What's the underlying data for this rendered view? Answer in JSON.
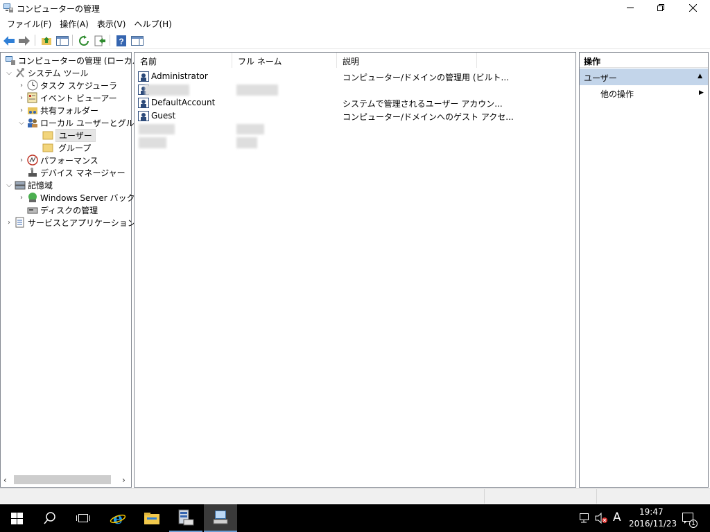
{
  "window": {
    "title": "コンピューターの管理"
  },
  "menu": [
    "ファイル(F)",
    "操作(A)",
    "表示(V)",
    "ヘルプ(H)"
  ],
  "tree": {
    "root": "コンピューターの管理 (ローカル)",
    "system_tools": "システム ツール",
    "task_scheduler": "タスク スケジューラ",
    "event_viewer": "イベント ビューアー",
    "shared_folders": "共有フォルダー",
    "local_users": "ローカル ユーザーとグループ",
    "users": "ユーザー",
    "groups": "グループ",
    "performance": "パフォーマンス",
    "device_manager": "デバイス マネージャー",
    "storage": "記憶域",
    "windows_backup": "Windows Server バックア",
    "disk_management": "ディスクの管理",
    "services_apps": "サービスとアプリケーション"
  },
  "list": {
    "columns": [
      "名前",
      "フル ネーム",
      "説明"
    ],
    "rows": [
      {
        "name": "Administrator",
        "fullname": "",
        "desc": "コンピューター/ドメインの管理用 (ビルト..."
      },
      {
        "name": "",
        "fullname": "",
        "desc": ""
      },
      {
        "name": "DefaultAccount",
        "fullname": "",
        "desc": "システムで管理されるユーザー アカウン..."
      },
      {
        "name": "Guest",
        "fullname": "",
        "desc": "コンピューター/ドメインへのゲスト アクセ..."
      },
      {
        "name": "",
        "fullname": "",
        "desc": ""
      },
      {
        "name": "",
        "fullname": "",
        "desc": ""
      }
    ]
  },
  "actions": {
    "header": "操作",
    "section": "ユーザー",
    "more": "他の操作"
  },
  "taskbar": {
    "time": "19:47",
    "date": "2016/11/23",
    "ime": "A",
    "notification_count": "1"
  },
  "colors": {
    "accent": "#c3d5ea",
    "taskbar": "#000000"
  }
}
